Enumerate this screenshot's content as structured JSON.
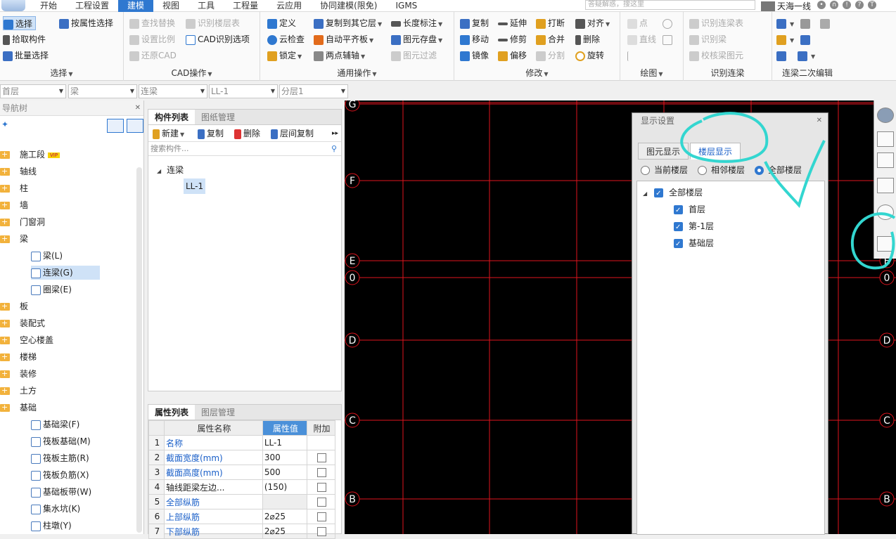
{
  "menu": {
    "tabs": [
      "开始",
      "工程设置",
      "建模",
      "视图",
      "工具",
      "工程量",
      "云应用",
      "协同建模(限免)",
      "IGMS"
    ],
    "active_tab": "建模",
    "search_placeholder": "答疑解惑，搜这里",
    "user": "天海一线"
  },
  "ribbon": {
    "select": {
      "caption": "选择",
      "items": [
        "选择",
        "按属性选择",
        "拾取构件",
        "批量选择"
      ]
    },
    "cad": {
      "caption": "CAD操作",
      "items": [
        "查找替换",
        "识别楼层表",
        "设置比例",
        "CAD识别选项",
        "还原CAD"
      ]
    },
    "common": {
      "caption": "通用操作",
      "items": [
        "定义",
        "复制到其它层",
        "长度标注",
        "云检查",
        "自动平齐板",
        "图元存盘",
        "锁定",
        "两点辅轴",
        "图元过滤"
      ]
    },
    "modify": {
      "caption": "修改",
      "items": [
        "复制",
        "延伸",
        "打断",
        "对齐",
        "移动",
        "修剪",
        "合并",
        "删除",
        "镜像",
        "偏移",
        "分割",
        "旋转"
      ]
    },
    "draw": {
      "caption": "绘图",
      "items": [
        "点",
        "直线"
      ]
    },
    "identify": {
      "caption": "识别连梁",
      "items": [
        "识别连梁表",
        "识别梁",
        "校核梁图元"
      ]
    },
    "secondary": {
      "caption": "连梁二次编辑"
    }
  },
  "selectors": [
    "首层",
    "梁",
    "连梁",
    "LL-1",
    "分层1"
  ],
  "nav": {
    "title": "导航树",
    "items": [
      {
        "label": "施工段",
        "vip": "VIP"
      },
      {
        "label": "轴线"
      },
      {
        "label": "柱"
      },
      {
        "label": "墙"
      },
      {
        "label": "门窗洞"
      },
      {
        "label": "梁"
      },
      {
        "label": "梁(L)",
        "sub": true
      },
      {
        "label": "连梁(G)",
        "sub": true,
        "selected": true
      },
      {
        "label": "圈梁(E)",
        "sub": true
      },
      {
        "label": "板"
      },
      {
        "label": "装配式"
      },
      {
        "label": "空心楼盖"
      },
      {
        "label": "楼梯"
      },
      {
        "label": "装修"
      },
      {
        "label": "土方"
      },
      {
        "label": "基础"
      },
      {
        "label": "基础梁(F)",
        "sub": true
      },
      {
        "label": "筏板基础(M)",
        "sub": true
      },
      {
        "label": "筏板主筋(R)",
        "sub": true
      },
      {
        "label": "筏板负筋(X)",
        "sub": true
      },
      {
        "label": "基础板带(W)",
        "sub": true
      },
      {
        "label": "集水坑(K)",
        "sub": true
      },
      {
        "label": "柱墩(Y)",
        "sub": true
      }
    ]
  },
  "component": {
    "tabs": [
      "构件列表",
      "图纸管理"
    ],
    "tools": [
      "新建",
      "复制",
      "删除",
      "层间复制"
    ],
    "search_placeholder": "搜索构件...",
    "tree_root": "连梁",
    "tree_child": "LL-1"
  },
  "property": {
    "tabs": [
      "属性列表",
      "图层管理"
    ],
    "headers": [
      "属性名称",
      "属性值",
      "附加"
    ],
    "rows": [
      {
        "n": "1",
        "name": "名称",
        "value": "LL-1",
        "blue": true,
        "cb": false
      },
      {
        "n": "2",
        "name": "截面宽度(mm)",
        "value": "300",
        "blue": true,
        "cb": true
      },
      {
        "n": "3",
        "name": "截面高度(mm)",
        "value": "500",
        "blue": true,
        "cb": true
      },
      {
        "n": "4",
        "name": "轴线距梁左边...",
        "value": "(150)",
        "blue": false,
        "cb": true
      },
      {
        "n": "5",
        "name": "全部纵筋",
        "value": "",
        "blue": true,
        "cb": true
      },
      {
        "n": "6",
        "name": "上部纵筋",
        "value": "2⌀25",
        "blue": true,
        "cb": true
      },
      {
        "n": "7",
        "name": "下部纵筋",
        "value": "2⌀25",
        "blue": true,
        "cb": true
      }
    ]
  },
  "axes": {
    "labels": [
      "G",
      "F",
      "E",
      "0",
      "D",
      "C",
      "B"
    ]
  },
  "dialog": {
    "title": "显示设置",
    "tabs": [
      "图元显示",
      "楼层显示"
    ],
    "active_tab": "楼层显示",
    "radios": [
      "当前楼层",
      "相邻楼层",
      "全部楼层"
    ],
    "selected_radio": "全部楼层",
    "tree_root": "全部楼层",
    "floors": [
      "首层",
      "第-1层",
      "基础层"
    ]
  },
  "colors": {
    "accent": "#2f78d0",
    "grid": "#e0141e",
    "annotation": "#33d6d0",
    "canvas": "#000000"
  }
}
